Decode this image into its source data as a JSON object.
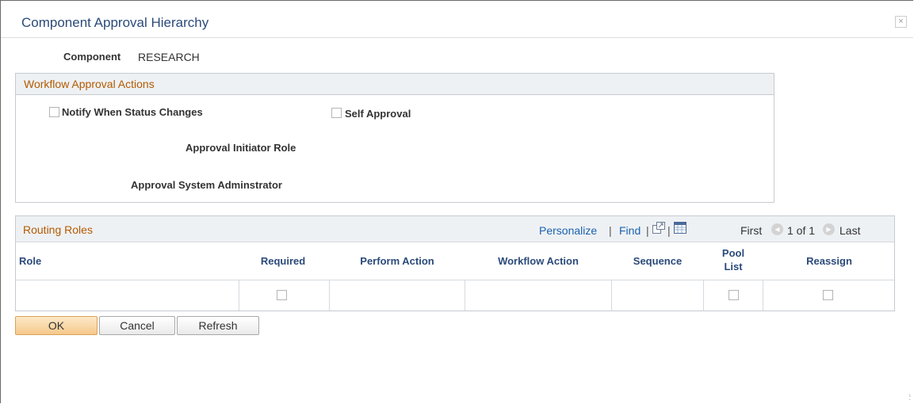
{
  "modal": {
    "title": "Component Approval Hierarchy",
    "close_label": "×"
  },
  "component": {
    "label": "Component",
    "value": "RESEARCH"
  },
  "workflow_actions": {
    "header": "Workflow Approval Actions",
    "notify_label": "Notify When Status Changes",
    "notify_checked": false,
    "self_approval_label": "Self Approval",
    "self_approval_checked": false,
    "initiator_role_label": "Approval Initiator Role",
    "initiator_role_value": "",
    "system_admin_label": "Approval System Adminstrator",
    "system_admin_value": ""
  },
  "routing_roles": {
    "header": "Routing Roles",
    "personalize_label": "Personalize",
    "find_label": "Find",
    "separator": "|",
    "nav_first": "First",
    "nav_position": "1 of 1",
    "nav_last": "Last",
    "columns": {
      "role": "Role",
      "required": "Required",
      "perform_action": "Perform Action",
      "workflow_action": "Workflow Action",
      "sequence": "Sequence",
      "pool_list_1": "Pool",
      "pool_list_2": "List",
      "reassign": "Reassign"
    },
    "rows": [
      {
        "role": "",
        "required": false,
        "perform_action": "",
        "workflow_action": "",
        "sequence": "",
        "pool_list": false,
        "reassign": false
      }
    ]
  },
  "buttons": {
    "ok": "OK",
    "cancel": "Cancel",
    "refresh": "Refresh"
  },
  "colors": {
    "title": "#2b4a7a",
    "section_header": "#b35a00",
    "link": "#1a62ad",
    "column_header": "#2b4a7a",
    "primary_button": "#f6c88b"
  }
}
